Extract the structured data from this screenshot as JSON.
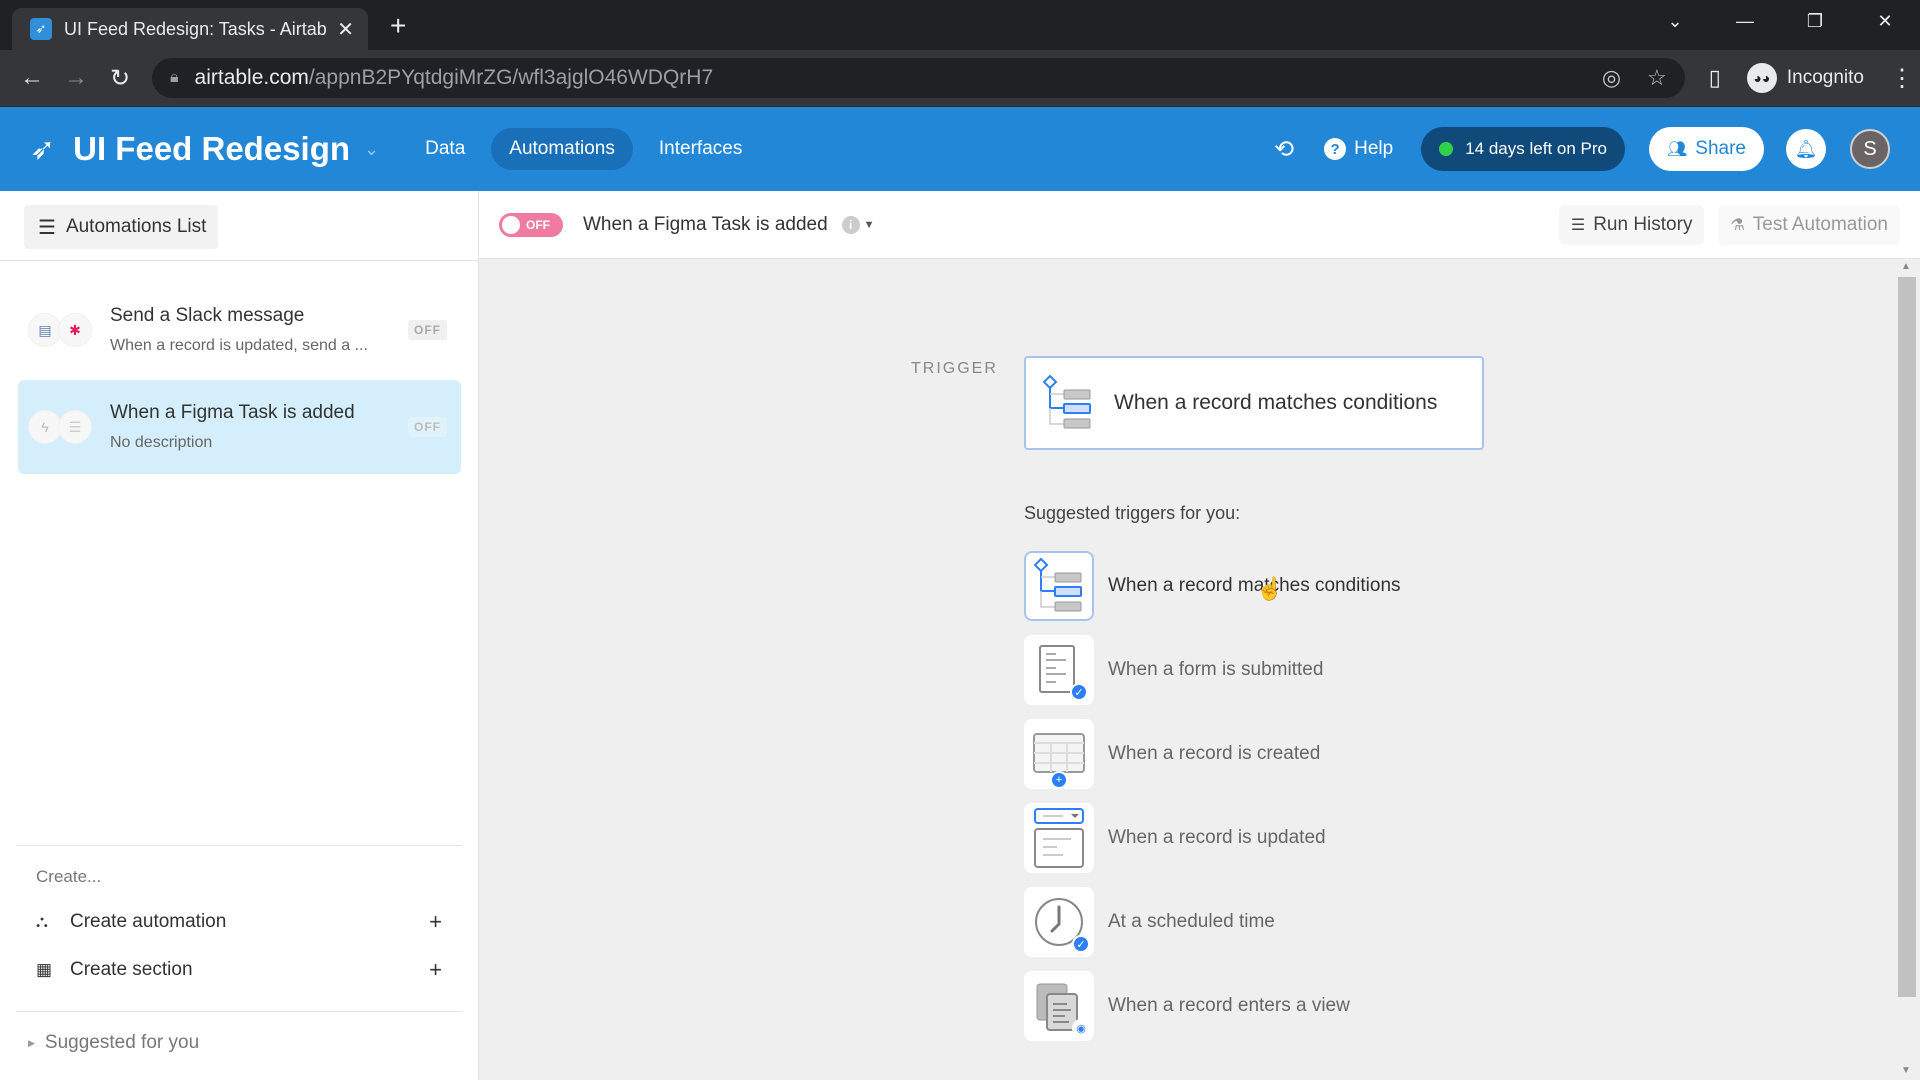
{
  "browser": {
    "tab_title": "UI Feed Redesign: Tasks - Airtable",
    "tab_favicon": "rocket-icon",
    "url_host": "airtable.com",
    "url_path": "/appnB2PYqtdgiMrZG/wfl3ajglO46WDQrH7",
    "profile_label": "Incognito",
    "icons": [
      "back-icon",
      "forward-icon",
      "reload-icon",
      "lock-icon",
      "eye-off-icon",
      "star-icon",
      "side-panel-icon",
      "incognito-icon",
      "kebab-menu-icon"
    ]
  },
  "appbar": {
    "base_name": "UI Feed Redesign",
    "nav_tabs": [
      {
        "label": "Data",
        "active": false
      },
      {
        "label": "Automations",
        "active": true
      },
      {
        "label": "Interfaces",
        "active": false
      }
    ],
    "help_label": "Help",
    "trial_label": "14 days left on Pro",
    "share_label": "Share",
    "avatar_initial": "S",
    "colors": {
      "brand": "#2287d7",
      "trial_bg": "#0f4a7a",
      "trial_dot": "#2fd24a"
    }
  },
  "sidebar": {
    "list_button_label": "Automations List",
    "automations": [
      {
        "title": "Send a Slack message",
        "description": "When a record is updated, send a ...",
        "status": "OFF",
        "selected": false,
        "icons": [
          "table-icon",
          "slack-icon"
        ]
      },
      {
        "title": "When a Figma Task is added",
        "description": "No description",
        "status": "OFF",
        "selected": true,
        "icons": [
          "lightning-icon",
          "list-icon"
        ]
      }
    ],
    "create_label": "Create...",
    "create_items": [
      {
        "label": "Create automation",
        "icon": "automation-icon"
      },
      {
        "label": "Create section",
        "icon": "section-icon"
      }
    ],
    "suggested_label": "Suggested for you"
  },
  "main": {
    "toggle_label": "OFF",
    "automation_name": "When a Figma Task is added",
    "run_history_label": "Run History",
    "test_automation_label": "Test Automation",
    "trigger_label": "TRIGGER",
    "trigger_card_label": "When a record matches conditions",
    "suggested_title": "Suggested triggers for you:",
    "suggested_triggers": [
      {
        "label": "When a record matches conditions",
        "icon": "conditions-icon",
        "hovered": true
      },
      {
        "label": "When a form is submitted",
        "icon": "form-icon",
        "hovered": false
      },
      {
        "label": "When a record is created",
        "icon": "record-created-icon",
        "hovered": false
      },
      {
        "label": "When a record is updated",
        "icon": "record-updated-icon",
        "hovered": false
      },
      {
        "label": "At a scheduled time",
        "icon": "clock-icon",
        "hovered": false
      },
      {
        "label": "When a record enters a view",
        "icon": "view-icon",
        "hovered": false
      }
    ],
    "colors": {
      "toggle_off": "#f07ba0",
      "selected_item": "#d4effb",
      "accent_blue": "#2d7ff9"
    }
  }
}
